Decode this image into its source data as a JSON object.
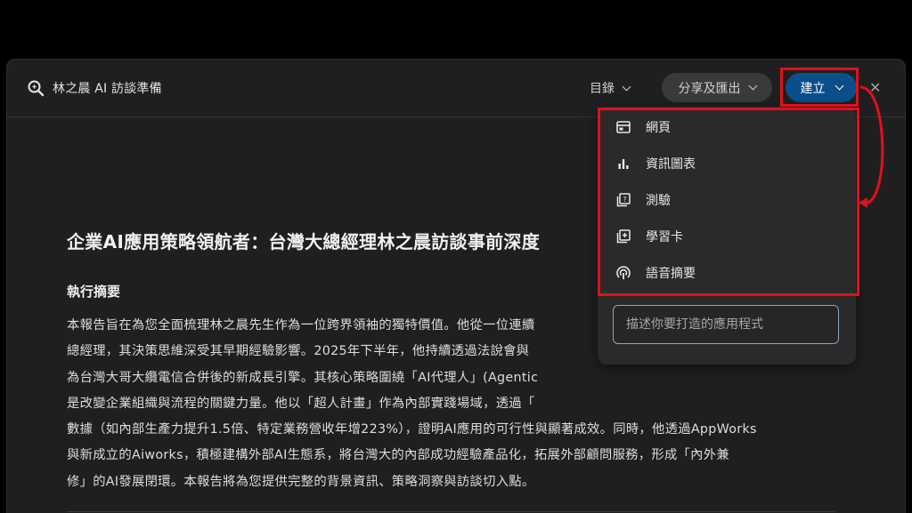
{
  "app": {
    "title": "林之晨 AI 訪談準備",
    "icon": "search-sparkle-icon"
  },
  "toolbar": {
    "toc_label": "目錄",
    "share_label": "分享及匯出",
    "create_label": "建立",
    "close_icon": "close-icon"
  },
  "document": {
    "title": "企業AI應用策略領航者：台灣大總經理林之晨訪談事前深度",
    "section_heading": "執行摘要",
    "lines": [
      "本報告旨在為您全面梳理林之晨先生作為一位跨界領袖的獨特價值。他從一位連續",
      "總經理，其決策思維深受其早期經驗影響。2025年下半年，他持續透過法說會與",
      "為台灣大哥大纜電信合併後的新成長引擎。其核心策略圍繞「AI代理人」(Agentic",
      "是改變企業組織與流程的關鍵力量。他以「超人計畫」作為內部實踐場域，透過「",
      "數據（如內部生產力提升1.5倍、特定業務營收年增223%），證明AI應用的可行性與顯著成效。同時，他透過AppWorks",
      "與新成立的Aiworks，積極建構外部AI生態系，將台灣大的內部成功經驗產品化，拓展外部顧問服務，形成「內外兼",
      "修」的AI發展閉環。本報告將為您提供完整的背景資訊、策略洞察與訪談切入點。"
    ]
  },
  "create_menu": {
    "items": [
      {
        "label": "網頁",
        "icon": "web-page-icon"
      },
      {
        "label": "資訊圖表",
        "icon": "bar-chart-icon"
      },
      {
        "label": "測驗",
        "icon": "quiz-icon"
      },
      {
        "label": "學習卡",
        "icon": "flashcard-icon"
      },
      {
        "label": "語音摘要",
        "icon": "audio-summary-icon"
      }
    ],
    "input_placeholder": "描述你要打造的應用程式"
  },
  "colors": {
    "background": "#000000",
    "panel": "#1f1f1f",
    "create_button": "#0b4f8a",
    "highlight": "#e0101d"
  }
}
